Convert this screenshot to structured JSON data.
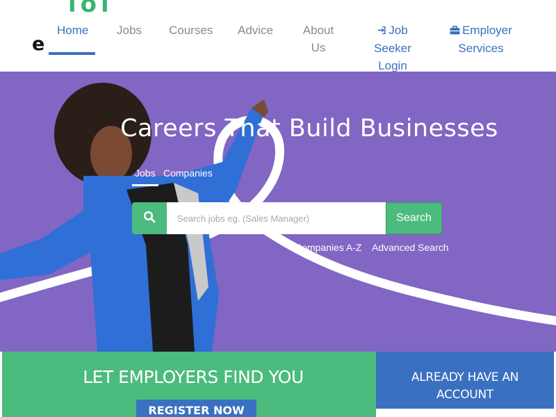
{
  "brand": {
    "logo_top_fragment": "lol",
    "logo_letter": "e",
    "accent_green": "#4cbb7e",
    "accent_blue": "#3a70c0",
    "hero_purple": "#8166c4"
  },
  "nav": {
    "home": "Home",
    "jobs": "Jobs",
    "courses": "Courses",
    "advice": "Advice",
    "about_line1": "About",
    "about_line2": "Us",
    "job_seeker_line1": "Job",
    "job_seeker_line2": "Seeker",
    "job_seeker_line3": "Login",
    "job_seeker_icon": "sign-in-icon",
    "employer_line1": "Employer",
    "employer_line2": "Services",
    "employer_icon": "briefcase-icon"
  },
  "hero": {
    "title": "Careers That Build Businesses",
    "tabs": {
      "jobs": "Jobs",
      "companies": "Companies"
    },
    "search": {
      "placeholder": "Search jobs eg. (Sales Manager)",
      "value": "",
      "button": "Search",
      "icon": "search-icon"
    },
    "links": {
      "companies_az": "Companies A-Z",
      "advanced_search": "Advanced Search"
    }
  },
  "banners": {
    "employers_title": "LET EMPLOYERS FIND YOU",
    "register": "REGISTER NOW",
    "account_line1": "ALREADY HAVE AN",
    "account_line2": "ACCOUNT"
  }
}
